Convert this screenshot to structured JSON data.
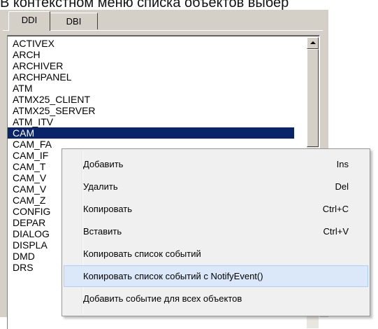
{
  "caption": "В контекстном меню списка объектов выбер",
  "tabs": [
    {
      "label": "DDI",
      "active": true
    },
    {
      "label": "DBI",
      "active": false
    }
  ],
  "list": {
    "items": [
      {
        "label": "ACTIVEX"
      },
      {
        "label": "ARCH"
      },
      {
        "label": "ARCHIVER"
      },
      {
        "label": "ARCHPANEL"
      },
      {
        "label": "ATM"
      },
      {
        "label": "ATMX25_CLIENT"
      },
      {
        "label": "ATMX25_SERVER"
      },
      {
        "label": "ATM_ITV"
      },
      {
        "label": "CAM",
        "selected": true
      },
      {
        "label": "CAM_FA"
      },
      {
        "label": "CAM_IF"
      },
      {
        "label": "CAM_T"
      },
      {
        "label": "CAM_V"
      },
      {
        "label": "CAM_V"
      },
      {
        "label": "CAM_Z"
      },
      {
        "label": "CONFIG"
      },
      {
        "label": "DEPAR"
      },
      {
        "label": "DIALOG"
      },
      {
        "label": "DISPLA"
      },
      {
        "label": "DMD"
      },
      {
        "label": "DRS"
      }
    ]
  },
  "context_menu": {
    "items": [
      {
        "label": "Добавить",
        "shortcut": "Ins"
      },
      {
        "label": "Удалить",
        "shortcut": "Del"
      },
      {
        "label": "Копировать",
        "shortcut": "Ctrl+C"
      },
      {
        "label": "Вставить",
        "shortcut": "Ctrl+V"
      },
      {
        "label": "Копировать список событий",
        "shortcut": ""
      },
      {
        "label": "Копировать список событий с NotifyEvent()",
        "shortcut": "",
        "highlighted": true
      },
      {
        "label": "Добавить событие для всех объектов",
        "shortcut": ""
      }
    ]
  },
  "colors": {
    "selection": "#0a246a",
    "menu_hover": "#dbe8f9",
    "panel": "#d4d0c8"
  },
  "icons": {
    "scroll_up": "scroll-up-arrow-icon"
  }
}
